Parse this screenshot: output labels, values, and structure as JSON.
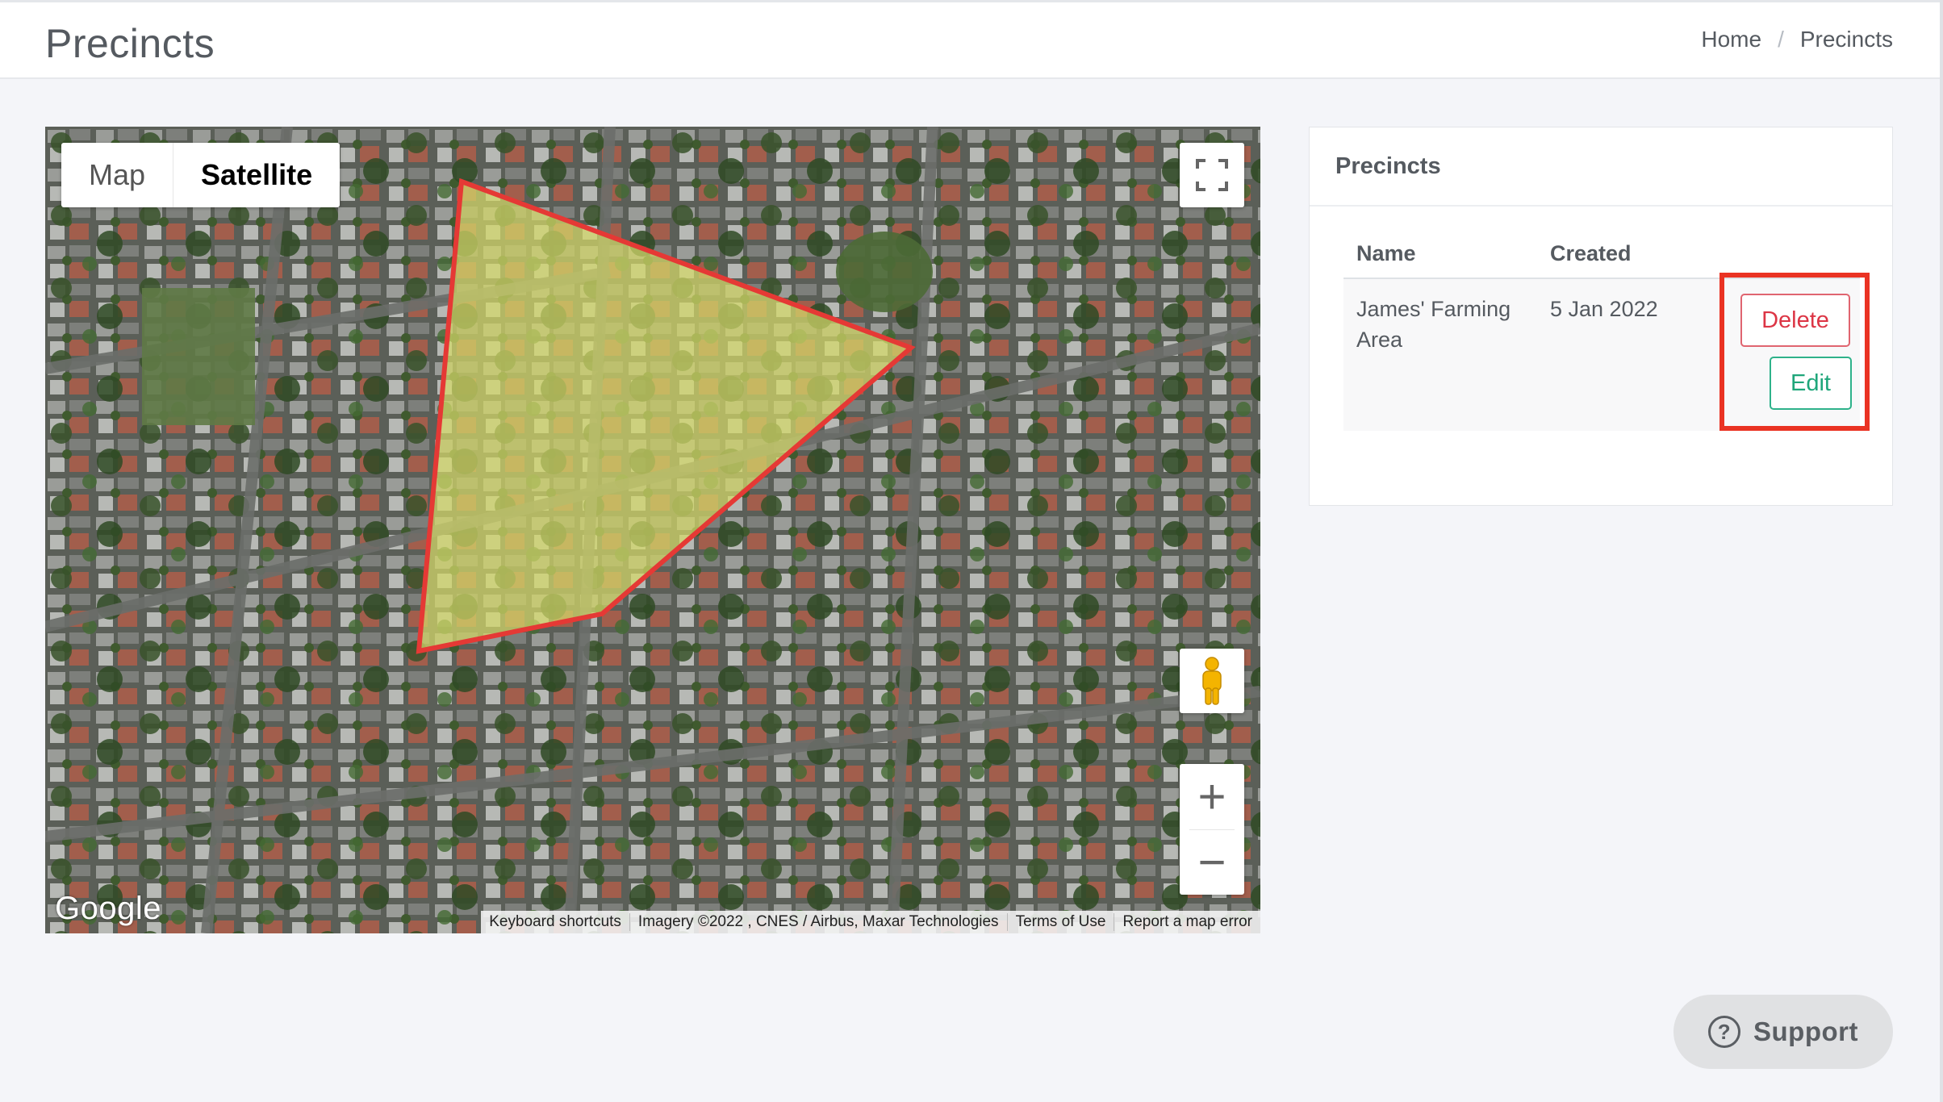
{
  "header": {
    "title": "Precincts",
    "breadcrumb": {
      "home": "Home",
      "separator": "/",
      "current": "Precincts"
    }
  },
  "map": {
    "type_options": {
      "map": "Map",
      "satellite": "Satellite"
    },
    "selected_type": "Satellite",
    "logo": "Google",
    "zoom_in": "+",
    "zoom_out": "−",
    "attribution": {
      "shortcuts": "Keyboard shortcuts",
      "imagery": "Imagery ©2022 , CNES / Airbus, Maxar Technologies",
      "terms": "Terms of Use",
      "report": "Report a map error"
    },
    "icons": [
      "fullscreen-icon",
      "pegman-icon"
    ],
    "polygon_color": "#e53935",
    "polygon_fill": "#d6d96a"
  },
  "precincts_card": {
    "title": "Precincts",
    "columns": {
      "name": "Name",
      "created": "Created"
    },
    "rows": [
      {
        "name": "James' Farming Area",
        "created": "5 Jan 2022",
        "delete_label": "Delete",
        "edit_label": "Edit"
      }
    ],
    "highlight_color": "#ea3323"
  },
  "support": {
    "icon": "?",
    "label": "Support"
  }
}
